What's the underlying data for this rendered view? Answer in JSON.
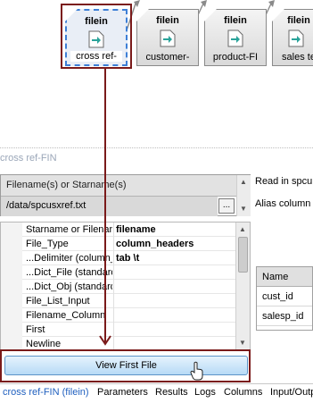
{
  "flow_nodes": [
    {
      "title": "filein",
      "label": "cross ref-",
      "selected": true
    },
    {
      "title": "filein",
      "label": "customer-",
      "selected": false
    },
    {
      "title": "filein",
      "label": "product-FI",
      "selected": false
    },
    {
      "title": "filein",
      "label": "sales te",
      "selected": false
    }
  ],
  "panel": {
    "title": "cross ref-FIN"
  },
  "filename_table": {
    "header": "Filename(s) or Starname(s)",
    "value": "/data/spcusxref.txt",
    "browse_label": "..."
  },
  "side_text": {
    "read_in": "Read in spcu",
    "alias": "Alias column r"
  },
  "properties": [
    {
      "name": "Starname or Filenam",
      "value": "filename"
    },
    {
      "name": "File_Type",
      "value": "column_headers"
    },
    {
      "name": "...Delimiter (column_l",
      "value": "tab \\t"
    },
    {
      "name": "...Dict_File (standard",
      "value": ""
    },
    {
      "name": "...Dict_Obj (standard",
      "value": ""
    },
    {
      "name": "File_List_Input",
      "value": ""
    },
    {
      "name": "Filename_Column",
      "value": ""
    },
    {
      "name": "First",
      "value": ""
    },
    {
      "name": "Newline",
      "value": ""
    }
  ],
  "name_table": {
    "header": "Name",
    "rows": [
      "cust_id",
      "salesp_id"
    ]
  },
  "view_button": {
    "label": "View First File"
  },
  "tabs": [
    {
      "label": "cross ref-FIN (filein)",
      "active": true
    },
    {
      "label": "Parameters",
      "active": false
    },
    {
      "label": "Results",
      "active": false
    },
    {
      "label": "Logs",
      "active": false
    },
    {
      "label": "Columns",
      "active": false
    },
    {
      "label": "Input/Outp",
      "active": false
    }
  ],
  "colors": {
    "highlight": "#7a1a1a",
    "active_tab": "#1f5fbf",
    "selection": "#3d7fd6"
  }
}
